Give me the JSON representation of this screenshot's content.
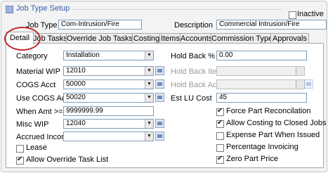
{
  "header": {
    "title": "Job Type Setup",
    "inactive_label": "Inactive"
  },
  "job_type": {
    "label": "Job Type",
    "value": "Com-Intrusion/Fire"
  },
  "description": {
    "label": "Description",
    "value": "Commercial Intrusion/Fire"
  },
  "tabs": [
    "Detail",
    "Job Tasks",
    "Override Job Tasks",
    "Costing",
    "Items",
    "Accounts",
    "Commission Types",
    "Approvals"
  ],
  "left": {
    "category": {
      "label": "Category",
      "value": "Installation"
    },
    "material_wip": {
      "label": "Material WIP",
      "value": "12010"
    },
    "cogs_acct": {
      "label": "COGS Acct",
      "value": "50000"
    },
    "use_cogs_acct": {
      "label": "Use COGS Acct",
      "value": "50020"
    },
    "when_amt": {
      "label": "When Amt >=",
      "value": "9999999.99"
    },
    "misc_wip": {
      "label": "Misc WIP",
      "value": "12040"
    },
    "accrued_income": {
      "label": "Accrued Income",
      "value": ""
    },
    "lease": {
      "label": "Lease",
      "checked": false
    },
    "allow_override": {
      "label": "Allow Override Task List",
      "checked": true
    }
  },
  "right": {
    "hold_back_pct": {
      "label": "Hold Back %",
      "value": "0.00"
    },
    "hold_back_item": {
      "label": "Hold Back Item",
      "value": ""
    },
    "hold_back_acct": {
      "label": "Hold Back Acct",
      "value": ""
    },
    "est_lu_cost": {
      "label": "Est LU Cost",
      "value": "45"
    },
    "force_part": {
      "label": "Force Part Reconcilation",
      "checked": true
    },
    "allow_costing": {
      "label": "Allow Costing to Closed Jobs",
      "checked": true
    },
    "expense_part": {
      "label": "Expense Part When Issued",
      "checked": false
    },
    "percentage_invoicing": {
      "label": "Percentage Invoicing",
      "checked": false
    },
    "zero_part_price": {
      "label": "Zero Part Price",
      "checked": true
    }
  }
}
